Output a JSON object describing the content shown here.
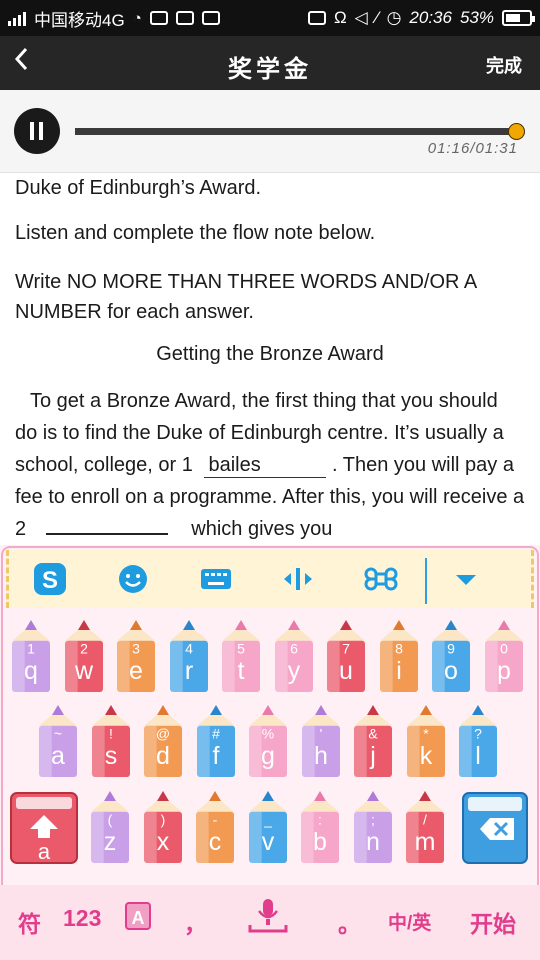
{
  "status_bar": {
    "carrier": "中国移动4G",
    "time": "20:36",
    "battery": "53%"
  },
  "nav": {
    "back_icon": "chevron-left-icon",
    "title": "奖学金",
    "done": "完成"
  },
  "player": {
    "state": "playing",
    "progress": 0.98,
    "time_label": "01:16/01:31"
  },
  "content": {
    "line1": "Duke of Edinburgh’s Award.",
    "line2": "Listen and complete the flow note below.",
    "instruction": "Write NO MORE THAN THREE WORDS AND/OR A NUMBER for each answer.",
    "subtitle": "Getting the Bronze Award",
    "para_a": "To get a Bronze Award, the first thing that you should do is to find the Duke of Edinburgh centre. It’s usually a school, college, or 1",
    "blank1": "bailes",
    "para_b": ". Then you will pay a fee to enroll on a programme. After this, you will receive a 2",
    "blank2": "",
    "para_c": "which gives you"
  },
  "keyboard": {
    "toolbar_icons": [
      "sogou-logo-icon",
      "emoji-icon",
      "keyboard-icon",
      "cursor-move-icon",
      "command-icon",
      "collapse-icon"
    ],
    "row1": [
      {
        "num": "1",
        "letter": "q"
      },
      {
        "num": "2",
        "letter": "w"
      },
      {
        "num": "3",
        "letter": "e"
      },
      {
        "num": "4",
        "letter": "r"
      },
      {
        "num": "5",
        "letter": "t"
      },
      {
        "num": "6",
        "letter": "y"
      },
      {
        "num": "7",
        "letter": "u"
      },
      {
        "num": "8",
        "letter": "i"
      },
      {
        "num": "9",
        "letter": "o"
      },
      {
        "num": "0",
        "letter": "p"
      }
    ],
    "row2": [
      {
        "num": "~",
        "letter": "a"
      },
      {
        "num": "!",
        "letter": "s"
      },
      {
        "num": "@",
        "letter": "d"
      },
      {
        "num": "#",
        "letter": "f"
      },
      {
        "num": "%",
        "letter": "g"
      },
      {
        "num": "'",
        "letter": "h"
      },
      {
        "num": "&",
        "letter": "j"
      },
      {
        "num": "*",
        "letter": "k"
      },
      {
        "num": "?",
        "letter": "l"
      }
    ],
    "row3": [
      {
        "num": "(",
        "letter": "z"
      },
      {
        "num": ")",
        "letter": "x"
      },
      {
        "num": "-",
        "letter": "c"
      },
      {
        "num": "_",
        "letter": "v"
      },
      {
        "num": ":",
        "letter": "b"
      },
      {
        "num": ";",
        "letter": "n"
      },
      {
        "num": "/",
        "letter": "m"
      }
    ],
    "shift_letter": "a",
    "bottom": {
      "symbols": "符",
      "numbers": "123",
      "comma": "，",
      "period": "。",
      "lang": "中/英",
      "go": "开始"
    }
  },
  "colors": {
    "status_bg": "#111111",
    "nav_bg": "#262626",
    "thumb": "#f0a800",
    "pink": "#e23c8c"
  }
}
